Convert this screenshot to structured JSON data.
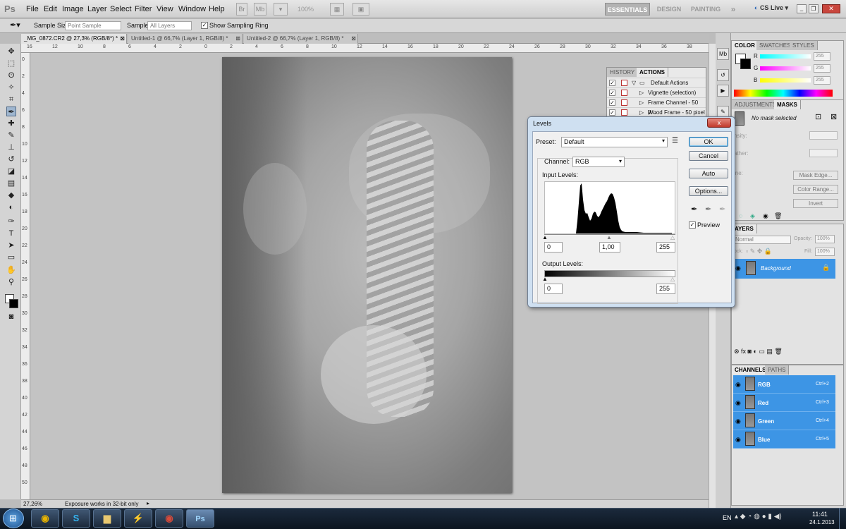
{
  "app": {
    "logo": "Ps"
  },
  "menu": [
    "File",
    "Edit",
    "Image",
    "Layer",
    "Select",
    "Filter",
    "View",
    "Window",
    "Help"
  ],
  "menubar": {
    "btn_br": "Br",
    "btn_mb": "Mb",
    "zoom": "100%",
    "workspaces": [
      "ESSENTIALS",
      "DESIGN",
      "PAINTING"
    ],
    "more": "»",
    "cslive": "CS Live"
  },
  "options": {
    "sample_size_label": "Sample Size:",
    "sample_size_value": "Point Sample",
    "sample_label": "Sample:",
    "sample_value": "All Layers",
    "ring_label": "Show Sampling Ring"
  },
  "doc_tabs": [
    "_MG_0872.CR2 @ 27,3% (RGB/8*) *",
    "Untitled-1 @ 66,7% (Layer 1, RGB/8) *",
    "Untitled-2 @ 66,7% (Layer 1, RGB/8) *"
  ],
  "ruler_top": [
    "16",
    "12",
    "10",
    "8",
    "6",
    "4",
    "2",
    "0",
    "2",
    "4",
    "6",
    "8",
    "10",
    "12",
    "14",
    "16",
    "18",
    "20",
    "22",
    "24",
    "26",
    "28",
    "30",
    "32",
    "34",
    "36",
    "38"
  ],
  "ruler_left": [
    "0",
    "2",
    "4",
    "6",
    "8",
    "10",
    "12",
    "14",
    "16",
    "18",
    "20",
    "22",
    "24",
    "26",
    "28",
    "30",
    "32",
    "34",
    "36",
    "38",
    "40",
    "42",
    "44",
    "46",
    "48",
    "50"
  ],
  "status": {
    "zoom": "27,26%",
    "info": "Exposure works in 32-bit only"
  },
  "history_panel": {
    "tabs": [
      "HISTORY",
      "ACTIONS"
    ],
    "rows": [
      "Default Actions",
      "Vignette (selection)",
      "Frame Channel - 50 p...",
      "Wood Frame - 50 pixel"
    ]
  },
  "color_panel": {
    "tabs": [
      "COLOR",
      "SWATCHES",
      "STYLES"
    ],
    "channels": [
      {
        "label": "R",
        "value": "255"
      },
      {
        "label": "G",
        "value": "255"
      },
      {
        "label": "B",
        "value": "255"
      }
    ]
  },
  "masks_panel": {
    "tabs": [
      "ADJUSTMENTS",
      "MASKS"
    ],
    "no_mask": "No mask selected",
    "density_label": "nsity:",
    "feather_label": "ather:",
    "refine_label": "ine:",
    "buttons": [
      "Mask Edge...",
      "Color Range...",
      "Invert"
    ]
  },
  "layers_panel": {
    "tab": "AYERS",
    "blend": "Normal",
    "opacity_label": "Opacity:",
    "opacity_value": "100%",
    "lock_label": "ock:",
    "fill_label": "Fill:",
    "fill_value": "100%",
    "layer_name": "Background"
  },
  "channels_panel": {
    "tabs": [
      "CHANNELS",
      "PATHS"
    ],
    "rows": [
      {
        "name": "RGB",
        "key": "Ctrl+2"
      },
      {
        "name": "Red",
        "key": "Ctrl+3"
      },
      {
        "name": "Green",
        "key": "Ctrl+4"
      },
      {
        "name": "Blue",
        "key": "Ctrl+5"
      }
    ]
  },
  "levels": {
    "title": "Levels",
    "preset_label": "Preset:",
    "preset_value": "Default",
    "channel_label": "Channel:",
    "channel_value": "RGB",
    "input_label": "Input Levels:",
    "input_black": "0",
    "input_gamma": "1,00",
    "input_white": "255",
    "output_label": "Output Levels:",
    "output_black": "0",
    "output_white": "255",
    "buttons": {
      "ok": "OK",
      "cancel": "Cancel",
      "auto": "Auto",
      "options": "Options..."
    },
    "preview_label": "Preview",
    "close": "x"
  },
  "taskbar": {
    "lang": "EN",
    "time": "11:41",
    "date": "24.1.2013"
  }
}
